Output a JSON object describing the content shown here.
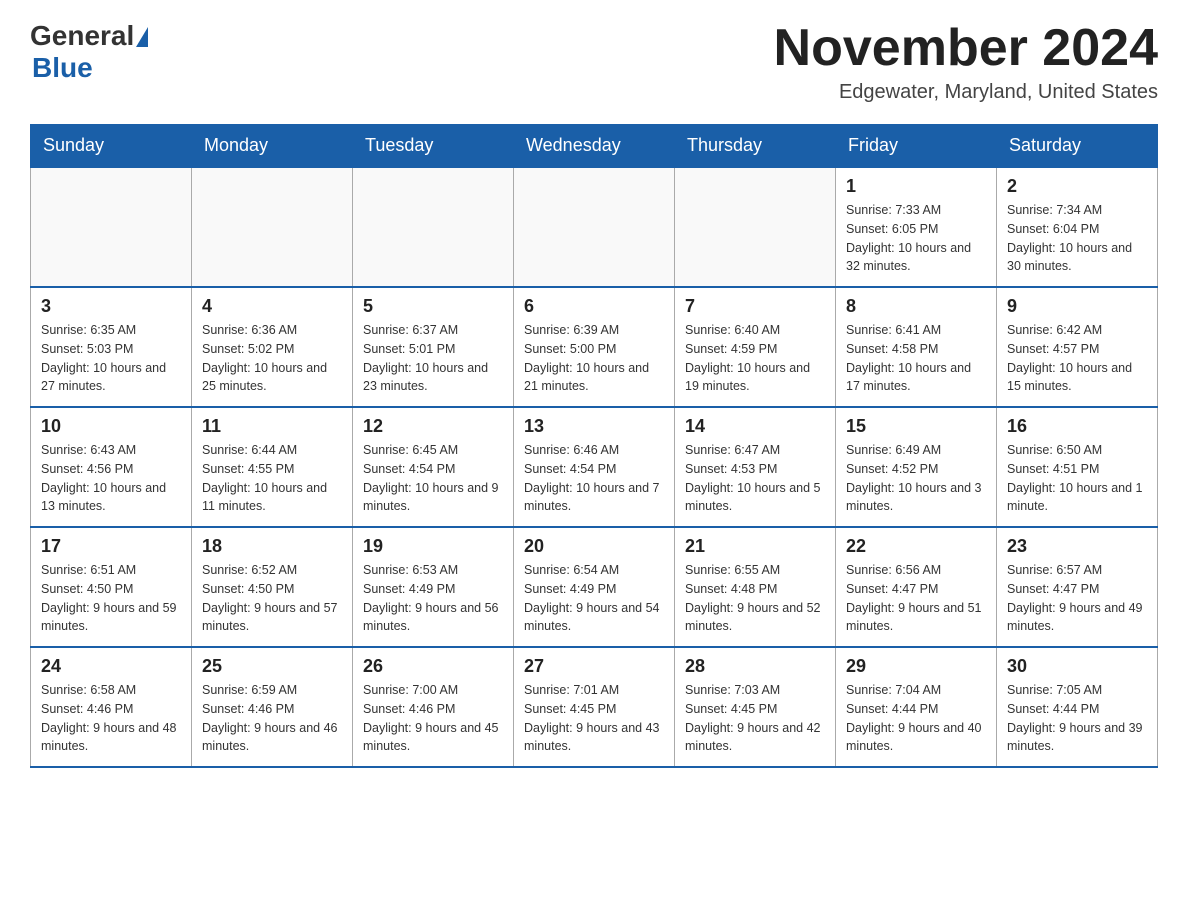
{
  "header": {
    "logo_general": "General",
    "logo_blue": "Blue",
    "title": "November 2024",
    "location": "Edgewater, Maryland, United States"
  },
  "weekdays": [
    "Sunday",
    "Monday",
    "Tuesday",
    "Wednesday",
    "Thursday",
    "Friday",
    "Saturday"
  ],
  "weeks": [
    [
      {
        "day": "",
        "sunrise": "",
        "sunset": "",
        "daylight": ""
      },
      {
        "day": "",
        "sunrise": "",
        "sunset": "",
        "daylight": ""
      },
      {
        "day": "",
        "sunrise": "",
        "sunset": "",
        "daylight": ""
      },
      {
        "day": "",
        "sunrise": "",
        "sunset": "",
        "daylight": ""
      },
      {
        "day": "",
        "sunrise": "",
        "sunset": "",
        "daylight": ""
      },
      {
        "day": "1",
        "sunrise": "Sunrise: 7:33 AM",
        "sunset": "Sunset: 6:05 PM",
        "daylight": "Daylight: 10 hours and 32 minutes."
      },
      {
        "day": "2",
        "sunrise": "Sunrise: 7:34 AM",
        "sunset": "Sunset: 6:04 PM",
        "daylight": "Daylight: 10 hours and 30 minutes."
      }
    ],
    [
      {
        "day": "3",
        "sunrise": "Sunrise: 6:35 AM",
        "sunset": "Sunset: 5:03 PM",
        "daylight": "Daylight: 10 hours and 27 minutes."
      },
      {
        "day": "4",
        "sunrise": "Sunrise: 6:36 AM",
        "sunset": "Sunset: 5:02 PM",
        "daylight": "Daylight: 10 hours and 25 minutes."
      },
      {
        "day": "5",
        "sunrise": "Sunrise: 6:37 AM",
        "sunset": "Sunset: 5:01 PM",
        "daylight": "Daylight: 10 hours and 23 minutes."
      },
      {
        "day": "6",
        "sunrise": "Sunrise: 6:39 AM",
        "sunset": "Sunset: 5:00 PM",
        "daylight": "Daylight: 10 hours and 21 minutes."
      },
      {
        "day": "7",
        "sunrise": "Sunrise: 6:40 AM",
        "sunset": "Sunset: 4:59 PM",
        "daylight": "Daylight: 10 hours and 19 minutes."
      },
      {
        "day": "8",
        "sunrise": "Sunrise: 6:41 AM",
        "sunset": "Sunset: 4:58 PM",
        "daylight": "Daylight: 10 hours and 17 minutes."
      },
      {
        "day": "9",
        "sunrise": "Sunrise: 6:42 AM",
        "sunset": "Sunset: 4:57 PM",
        "daylight": "Daylight: 10 hours and 15 minutes."
      }
    ],
    [
      {
        "day": "10",
        "sunrise": "Sunrise: 6:43 AM",
        "sunset": "Sunset: 4:56 PM",
        "daylight": "Daylight: 10 hours and 13 minutes."
      },
      {
        "day": "11",
        "sunrise": "Sunrise: 6:44 AM",
        "sunset": "Sunset: 4:55 PM",
        "daylight": "Daylight: 10 hours and 11 minutes."
      },
      {
        "day": "12",
        "sunrise": "Sunrise: 6:45 AM",
        "sunset": "Sunset: 4:54 PM",
        "daylight": "Daylight: 10 hours and 9 minutes."
      },
      {
        "day": "13",
        "sunrise": "Sunrise: 6:46 AM",
        "sunset": "Sunset: 4:54 PM",
        "daylight": "Daylight: 10 hours and 7 minutes."
      },
      {
        "day": "14",
        "sunrise": "Sunrise: 6:47 AM",
        "sunset": "Sunset: 4:53 PM",
        "daylight": "Daylight: 10 hours and 5 minutes."
      },
      {
        "day": "15",
        "sunrise": "Sunrise: 6:49 AM",
        "sunset": "Sunset: 4:52 PM",
        "daylight": "Daylight: 10 hours and 3 minutes."
      },
      {
        "day": "16",
        "sunrise": "Sunrise: 6:50 AM",
        "sunset": "Sunset: 4:51 PM",
        "daylight": "Daylight: 10 hours and 1 minute."
      }
    ],
    [
      {
        "day": "17",
        "sunrise": "Sunrise: 6:51 AM",
        "sunset": "Sunset: 4:50 PM",
        "daylight": "Daylight: 9 hours and 59 minutes."
      },
      {
        "day": "18",
        "sunrise": "Sunrise: 6:52 AM",
        "sunset": "Sunset: 4:50 PM",
        "daylight": "Daylight: 9 hours and 57 minutes."
      },
      {
        "day": "19",
        "sunrise": "Sunrise: 6:53 AM",
        "sunset": "Sunset: 4:49 PM",
        "daylight": "Daylight: 9 hours and 56 minutes."
      },
      {
        "day": "20",
        "sunrise": "Sunrise: 6:54 AM",
        "sunset": "Sunset: 4:49 PM",
        "daylight": "Daylight: 9 hours and 54 minutes."
      },
      {
        "day": "21",
        "sunrise": "Sunrise: 6:55 AM",
        "sunset": "Sunset: 4:48 PM",
        "daylight": "Daylight: 9 hours and 52 minutes."
      },
      {
        "day": "22",
        "sunrise": "Sunrise: 6:56 AM",
        "sunset": "Sunset: 4:47 PM",
        "daylight": "Daylight: 9 hours and 51 minutes."
      },
      {
        "day": "23",
        "sunrise": "Sunrise: 6:57 AM",
        "sunset": "Sunset: 4:47 PM",
        "daylight": "Daylight: 9 hours and 49 minutes."
      }
    ],
    [
      {
        "day": "24",
        "sunrise": "Sunrise: 6:58 AM",
        "sunset": "Sunset: 4:46 PM",
        "daylight": "Daylight: 9 hours and 48 minutes."
      },
      {
        "day": "25",
        "sunrise": "Sunrise: 6:59 AM",
        "sunset": "Sunset: 4:46 PM",
        "daylight": "Daylight: 9 hours and 46 minutes."
      },
      {
        "day": "26",
        "sunrise": "Sunrise: 7:00 AM",
        "sunset": "Sunset: 4:46 PM",
        "daylight": "Daylight: 9 hours and 45 minutes."
      },
      {
        "day": "27",
        "sunrise": "Sunrise: 7:01 AM",
        "sunset": "Sunset: 4:45 PM",
        "daylight": "Daylight: 9 hours and 43 minutes."
      },
      {
        "day": "28",
        "sunrise": "Sunrise: 7:03 AM",
        "sunset": "Sunset: 4:45 PM",
        "daylight": "Daylight: 9 hours and 42 minutes."
      },
      {
        "day": "29",
        "sunrise": "Sunrise: 7:04 AM",
        "sunset": "Sunset: 4:44 PM",
        "daylight": "Daylight: 9 hours and 40 minutes."
      },
      {
        "day": "30",
        "sunrise": "Sunrise: 7:05 AM",
        "sunset": "Sunset: 4:44 PM",
        "daylight": "Daylight: 9 hours and 39 minutes."
      }
    ]
  ]
}
